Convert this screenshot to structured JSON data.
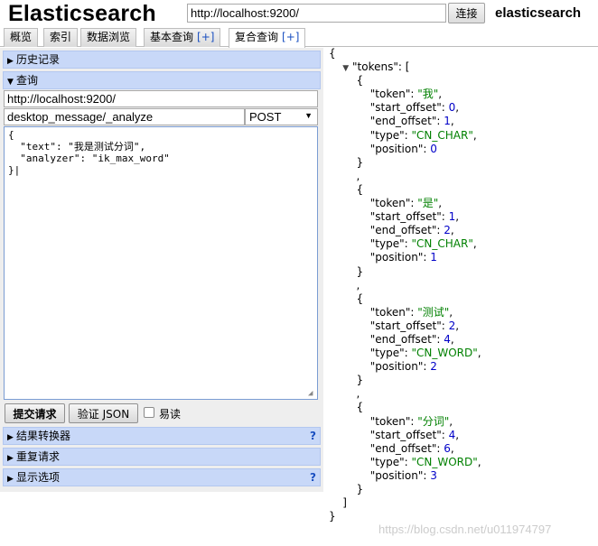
{
  "header": {
    "app_title": "Elasticsearch",
    "url_value": "http://localhost:9200/",
    "connect_label": "连接",
    "cluster_name": "elasticsearch"
  },
  "tabs": [
    {
      "label": "概览"
    },
    {
      "label": "索引"
    },
    {
      "label": "数据浏览"
    },
    {
      "label": "基本查询",
      "plus": "[+]"
    },
    {
      "label": "复合查询",
      "plus": "[+]"
    }
  ],
  "left": {
    "history_label": "历史记录",
    "query_label": "查询",
    "query_url": "http://localhost:9200/",
    "path": "desktop_message/_analyze",
    "method": "POST",
    "body_lines": [
      "{",
      "  \"text\": \"我是测试分词\",",
      "  \"analyzer\": \"ik_max_word\"",
      "}|"
    ],
    "submit_label": "提交请求",
    "validate_label": "验证 JSON",
    "readonly_label": "易读",
    "transformer_label": "结果转换器",
    "repeat_label": "重复请求",
    "display_label": "显示选项",
    "help_mark": "?"
  },
  "output": {
    "open_brace": "{",
    "close_brace": "}",
    "array_close": "]",
    "tokens_key": "\"tokens\": [",
    "tokens": [
      {
        "token": "\"我\"",
        "start_offset": "0",
        "end_offset": "1",
        "type": "\"CN_CHAR\"",
        "position": "0"
      },
      {
        "token": "\"是\"",
        "start_offset": "1",
        "end_offset": "2",
        "type": "\"CN_CHAR\"",
        "position": "1"
      },
      {
        "token": "\"测试\"",
        "start_offset": "2",
        "end_offset": "4",
        "type": "\"CN_WORD\"",
        "position": "2"
      },
      {
        "token": "\"分词\"",
        "start_offset": "4",
        "end_offset": "6",
        "type": "\"CN_WORD\"",
        "position": "3"
      }
    ]
  },
  "watermark": "https://blog.csdn.net/u011974797",
  "colors": {
    "section_bg": "#c8d8f8",
    "string": "#008000",
    "number": "#0000c8",
    "help": "#1a4fc0"
  }
}
